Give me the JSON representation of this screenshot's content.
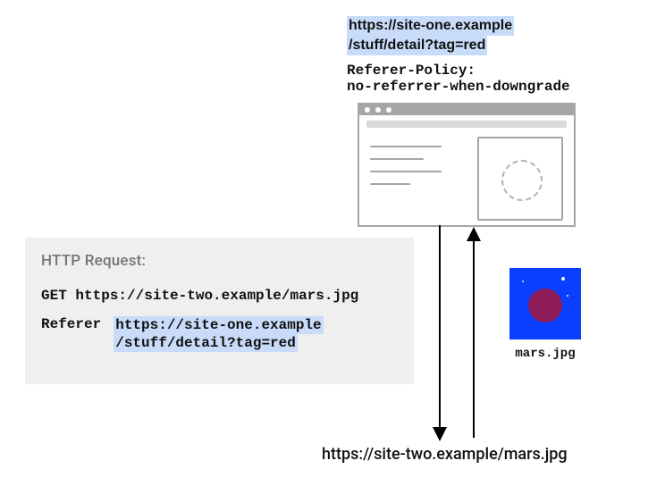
{
  "top_url": {
    "line1": "https://site-one.example",
    "line2": "/stuff/detail?tag=red"
  },
  "policy": {
    "line1": "Referer-Policy:",
    "line2": "no-referrer-when-downgrade"
  },
  "request": {
    "label": "HTTP Request:",
    "method": "GET",
    "target": "https://site-two.example/mars.jpg",
    "header_name": "Referer",
    "header_value_line1": "https://site-one.example",
    "header_value_line2": "/stuff/detail?tag=red"
  },
  "image": {
    "filename": "mars.jpg"
  },
  "bottom_url": "https://site-two.example/mars.jpg"
}
